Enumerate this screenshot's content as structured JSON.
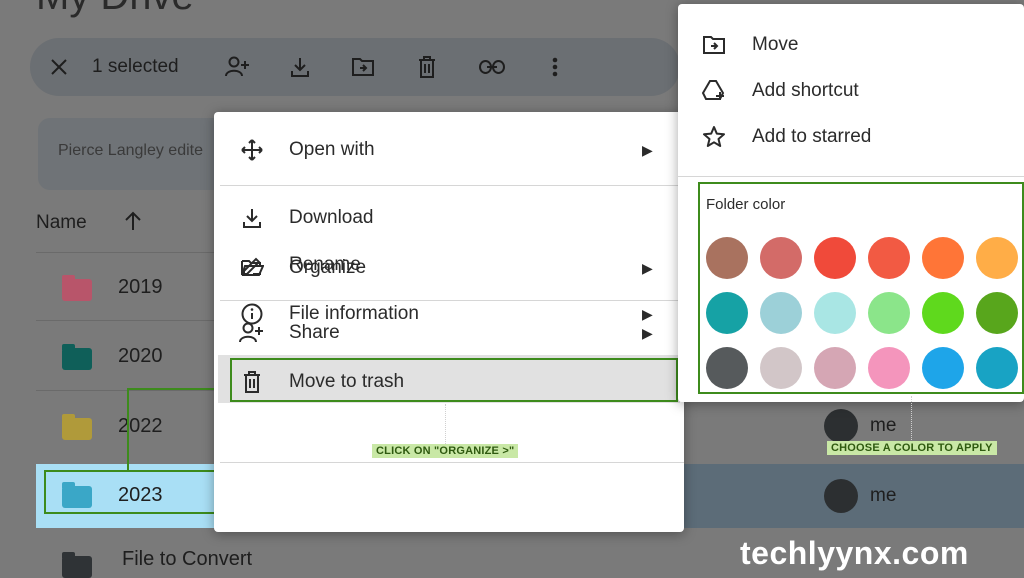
{
  "page": {
    "title": "My Drive"
  },
  "toolbar": {
    "selection_text": "1 selected",
    "icons": [
      "close-icon",
      "add-person-icon",
      "download-icon",
      "move-to-folder-icon",
      "trash-icon",
      "link-icon",
      "more-vert-icon"
    ]
  },
  "suggestion": {
    "text": "Pierce Langley edite"
  },
  "list": {
    "column_name": "Name",
    "sort_icon": "arrow-up-icon",
    "rows": [
      {
        "label": "2019",
        "folder_color": "#b8556a"
      },
      {
        "label": "2020",
        "folder_color": "#0f5f59"
      },
      {
        "label": "2022",
        "folder_color": "#b09a3a"
      },
      {
        "label": "2023",
        "folder_color": "#3aa7c7"
      },
      {
        "label": "File to Convert",
        "folder_color": "#2f3336"
      }
    ],
    "owner_me_1": "me",
    "owner_me_2": "me",
    "owner_partial": "me"
  },
  "context_menu": {
    "items": [
      {
        "label": "Open with",
        "icon": "move-arrows-icon",
        "has_submenu": true
      },
      {
        "label": "Download",
        "icon": "download-icon",
        "has_submenu": false
      },
      {
        "label": "Rename",
        "icon": "edit-icon",
        "has_submenu": false
      },
      {
        "label": "Share",
        "icon": "add-person-icon",
        "has_submenu": true
      },
      {
        "label": "Organize",
        "icon": "folder-open-icon",
        "has_submenu": true
      },
      {
        "label": "File information",
        "icon": "info-icon",
        "has_submenu": true
      },
      {
        "label": "Move to trash",
        "icon": "trash-icon",
        "has_submenu": false
      }
    ]
  },
  "organize_submenu": {
    "items": [
      {
        "label": "Move",
        "icon": "move-to-folder-icon"
      },
      {
        "label": "Add shortcut",
        "icon": "add-shortcut-icon"
      },
      {
        "label": "Add to starred",
        "icon": "star-icon"
      }
    ],
    "folder_color_title": "Folder color",
    "colors": [
      "#a9725f",
      "#d36b68",
      "#f04a3a",
      "#f25a43",
      "#ff7537",
      "#ffad47",
      "#16a2a5",
      "#9cd0d8",
      "#a9e6e4",
      "#8be58a",
      "#5fd91d",
      "#58a61c",
      "#565a5c",
      "#d2c6c8",
      "#d5a6b4",
      "#f495bc",
      "#1ea5e9",
      "#18a3c4"
    ]
  },
  "annotations": {
    "organize_callout": "CLICK ON \"ORGANIZE >\"",
    "color_callout": "CHOOSE A COLOR TO APPLY"
  },
  "accent_color": "#3d8b1c",
  "watermark": "techlyynx.com"
}
